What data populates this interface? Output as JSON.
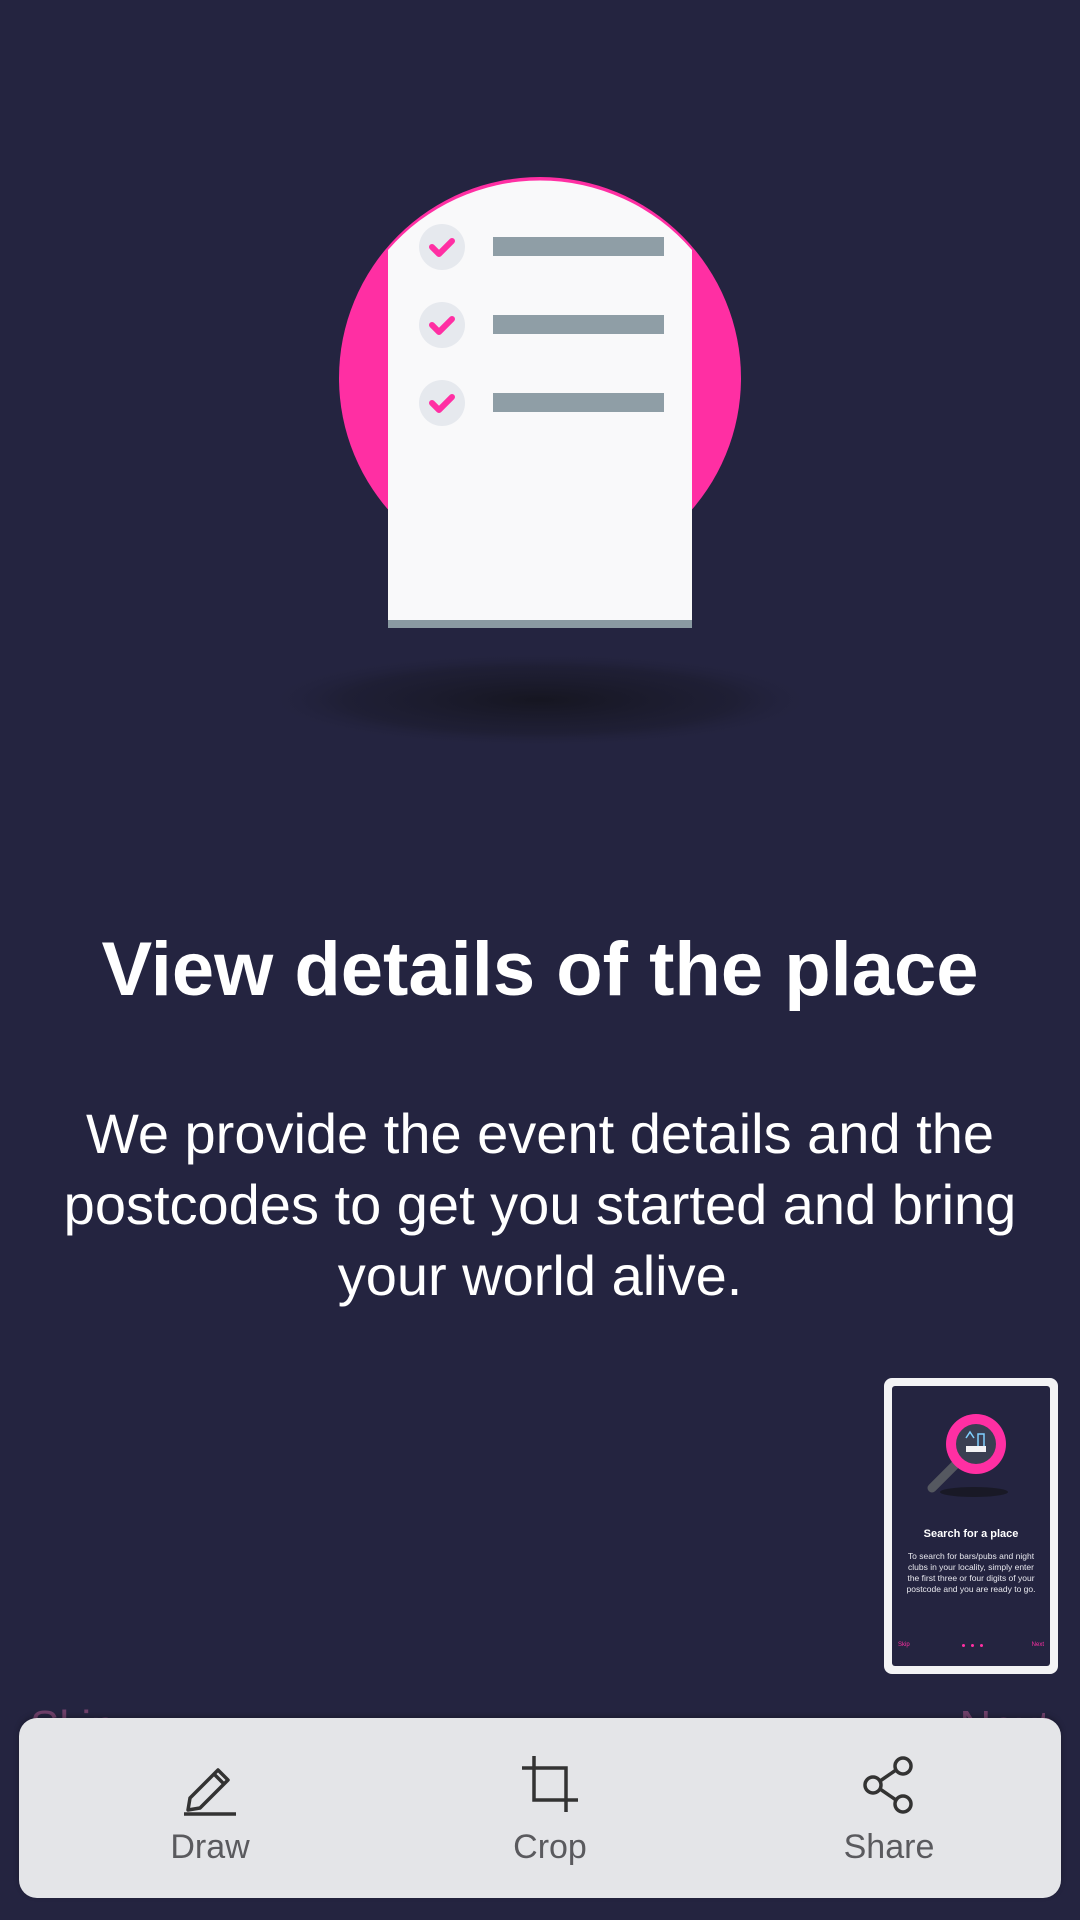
{
  "onboarding": {
    "title": "View details of the place",
    "description": "We provide the event details and the postcodes to get you started and bring your world alive.",
    "skip_label": "Skip",
    "next_label": "Next",
    "page_count": 3,
    "active_page": 3
  },
  "preview_thumbnail": {
    "title": "Search for a place",
    "description": "To search for bars/pubs and night clubs in your locality, simply enter the first three or four digits of your postcode and you are ready to go.",
    "skip_label": "Skip",
    "next_label": "Next"
  },
  "screenshot_toolbar": {
    "draw_label": "Draw",
    "crop_label": "Crop",
    "share_label": "Share"
  },
  "colors": {
    "background": "#242440",
    "accent": "#ff2fa3",
    "toolbar": "#e4e5e8"
  }
}
